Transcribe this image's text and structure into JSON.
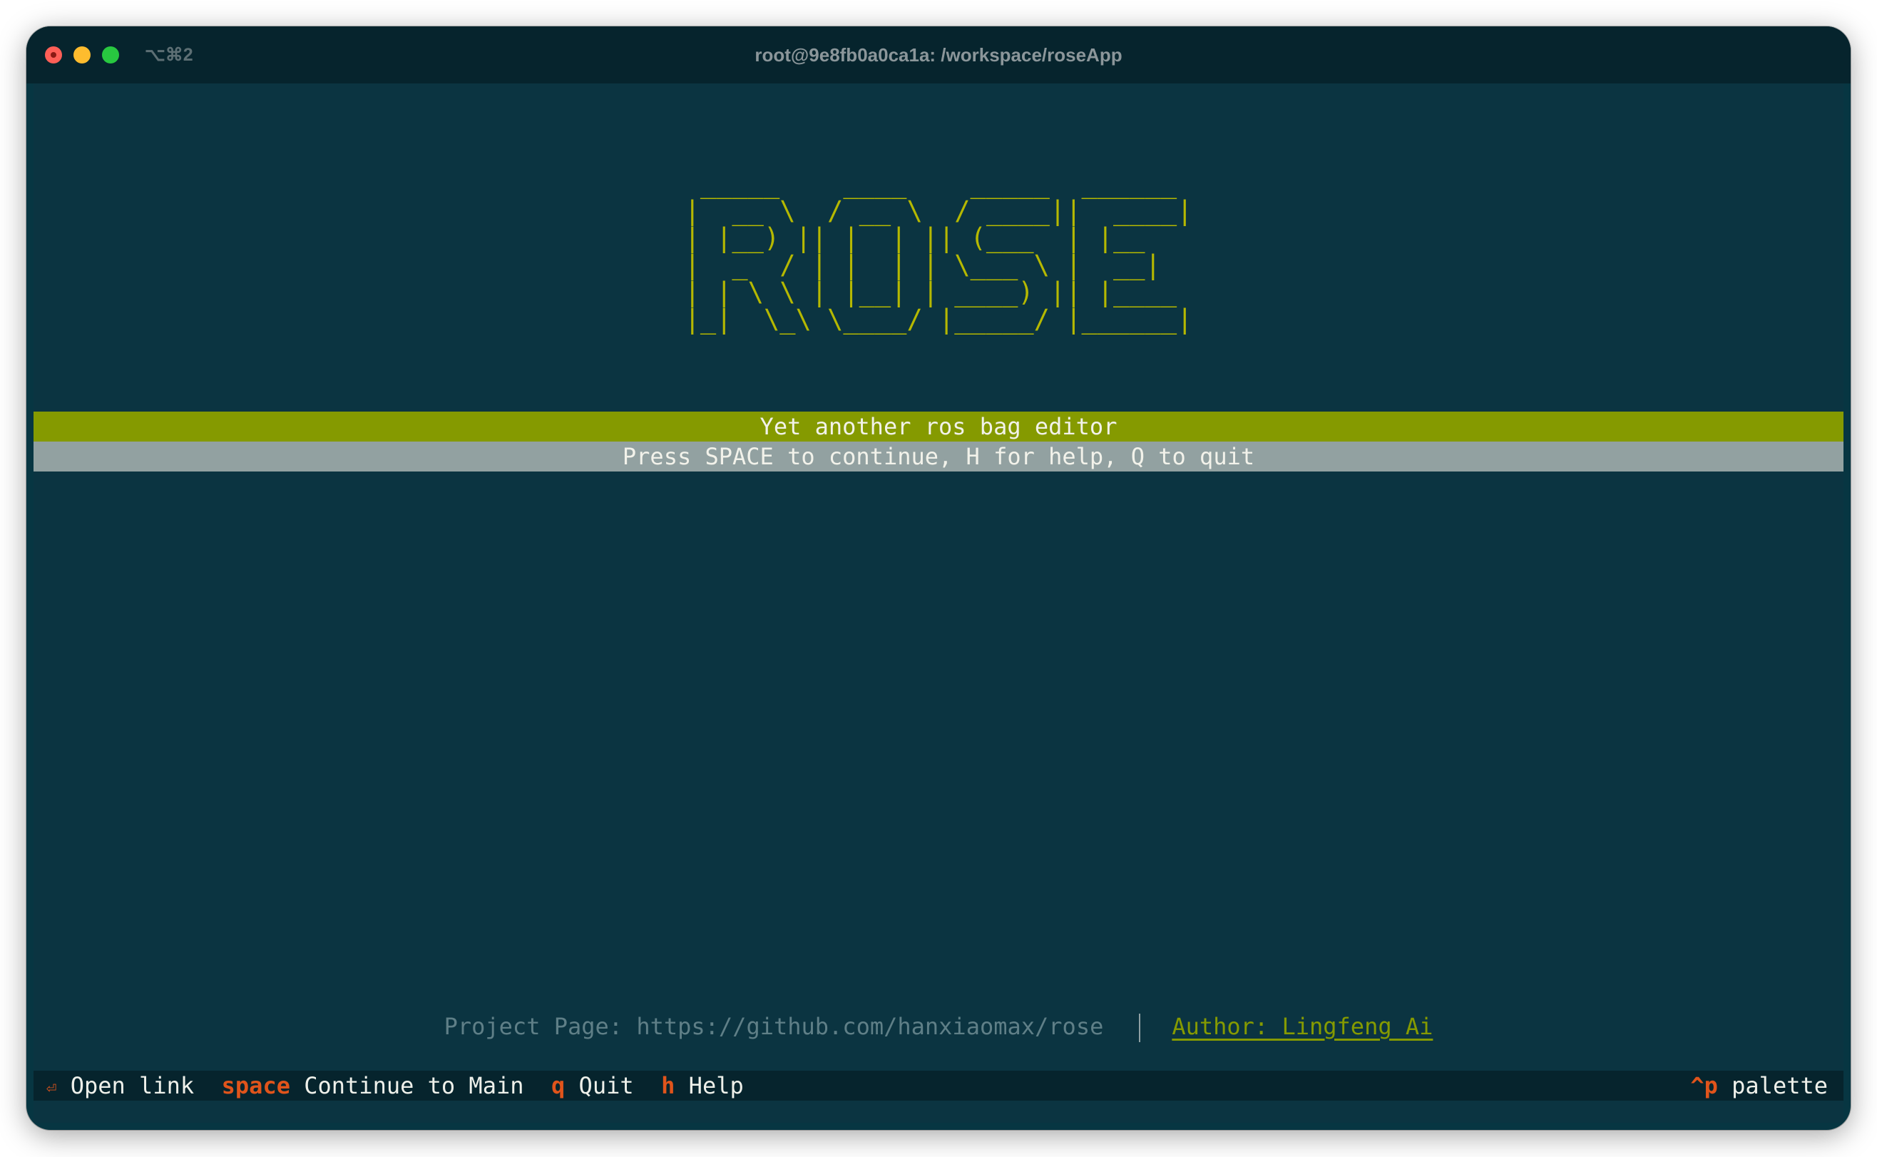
{
  "window": {
    "shortcut": "⌥⌘2",
    "title": "root@9e8fb0a0ca1a: /workspace/roseApp"
  },
  "logo": {
    "ascii": " _____    ____    _____  ______ \n|  __ \\  / __ \\  / ____||  ____|\n| |__) || |  | || (___  | |__   \n|  _  / | |  | | \\___ \\ |  __|  \n| | \\ \\ | |__| | ____) || |____ \n|_|  \\_\\ \\____/ |_____/ |______|",
    "text": "ROSE"
  },
  "banner": {
    "tagline": "Yet another ros bag editor",
    "prompt": "Press SPACE to continue, H for help, Q to quit"
  },
  "footer": {
    "project_page": "Project Page: https://github.com/hanxiaomax/rose",
    "author": "Author: Lingfeng_Ai"
  },
  "keybar": {
    "items": [
      {
        "key": "⏎",
        "label": "Open link"
      },
      {
        "key": "space",
        "label": "Continue to Main"
      },
      {
        "key": "q",
        "label": "Quit"
      },
      {
        "key": "h",
        "label": "Help"
      }
    ],
    "palette": {
      "key": "^p",
      "label": "palette"
    }
  },
  "colors": {
    "background": "#0b3441",
    "titlebar": "#06242d",
    "logo": "#b5b800",
    "tagline_bg": "#859a00",
    "prompt_bg": "#92a1a1",
    "key": "#e0541b",
    "author": "#859a00"
  }
}
